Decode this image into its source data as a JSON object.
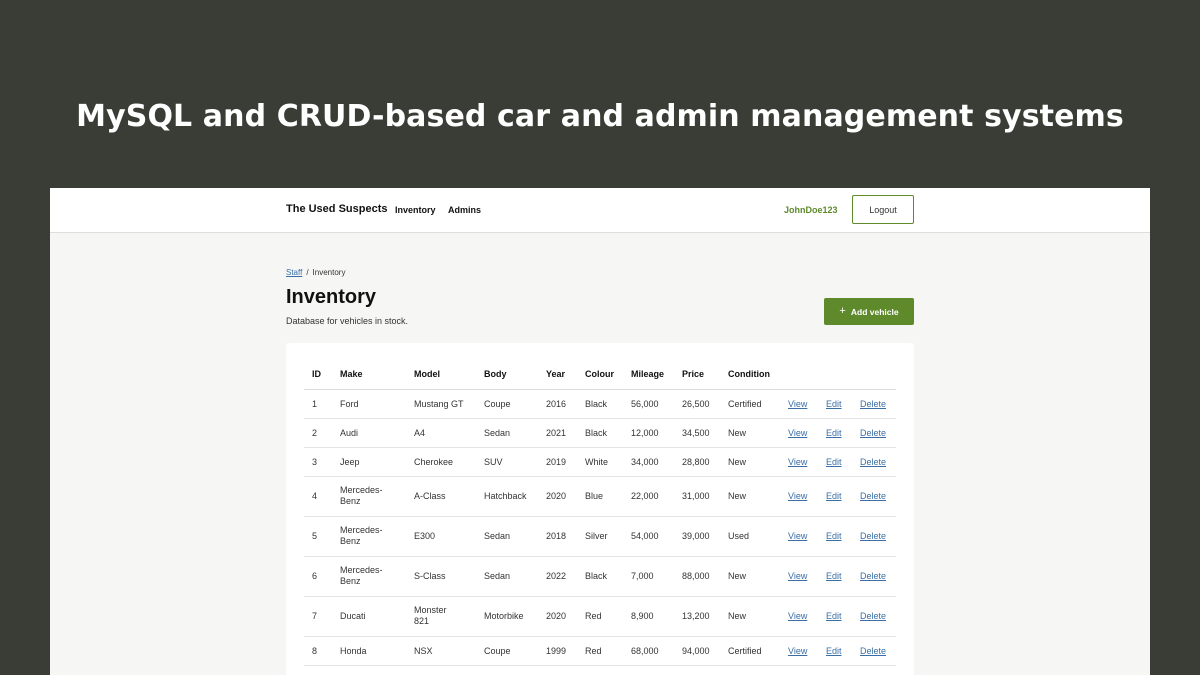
{
  "headline": "MySQL and CRUD-based car and admin management systems",
  "nav": {
    "brand": "The Used Suspects",
    "links": [
      "Inventory",
      "Admins"
    ],
    "username": "JohnDoe123",
    "logout_label": "Logout"
  },
  "breadcrumb": {
    "parent": "Staff",
    "separator": "/",
    "current": "Inventory"
  },
  "page": {
    "title": "Inventory",
    "subtitle": "Database for vehicles in stock.",
    "add_icon": "plus-icon",
    "add_label": "Add vehicle"
  },
  "table": {
    "headers": [
      "ID",
      "Make",
      "Model",
      "Body",
      "Year",
      "Colour",
      "Mileage",
      "Price",
      "Condition"
    ],
    "action_labels": {
      "view": "View",
      "edit": "Edit",
      "delete": "Delete"
    },
    "rows": [
      {
        "id": "1",
        "make": "Ford",
        "model": "Mustang GT",
        "body": "Coupe",
        "year": "2016",
        "colour": "Black",
        "mileage": "56,000",
        "price": "26,500",
        "condition": "Certified"
      },
      {
        "id": "2",
        "make": "Audi",
        "model": "A4",
        "body": "Sedan",
        "year": "2021",
        "colour": "Black",
        "mileage": "12,000",
        "price": "34,500",
        "condition": "New"
      },
      {
        "id": "3",
        "make": "Jeep",
        "model": "Cherokee",
        "body": "SUV",
        "year": "2019",
        "colour": "White",
        "mileage": "34,000",
        "price": "28,800",
        "condition": "New"
      },
      {
        "id": "4",
        "make": "Mercedes-Benz",
        "model": "A-Class",
        "body": "Hatchback",
        "year": "2020",
        "colour": "Blue",
        "mileage": "22,000",
        "price": "31,000",
        "condition": "New"
      },
      {
        "id": "5",
        "make": "Mercedes-Benz",
        "model": "E300",
        "body": "Sedan",
        "year": "2018",
        "colour": "Silver",
        "mileage": "54,000",
        "price": "39,000",
        "condition": "Used"
      },
      {
        "id": "6",
        "make": "Mercedes-Benz",
        "model": "S-Class",
        "body": "Sedan",
        "year": "2022",
        "colour": "Black",
        "mileage": "7,000",
        "price": "88,000",
        "condition": "New"
      },
      {
        "id": "7",
        "make": "Ducati",
        "model": "Monster 821",
        "body": "Motorbike",
        "year": "2020",
        "colour": "Red",
        "mileage": "8,900",
        "price": "13,200",
        "condition": "New"
      },
      {
        "id": "8",
        "make": "Honda",
        "model": "NSX",
        "body": "Coupe",
        "year": "1999",
        "colour": "Red",
        "mileage": "68,000",
        "price": "94,000",
        "condition": "Certified"
      }
    ]
  },
  "colors": {
    "background": "#3a3d35",
    "accent": "#5f8a2c",
    "link": "#3a6ea5"
  }
}
